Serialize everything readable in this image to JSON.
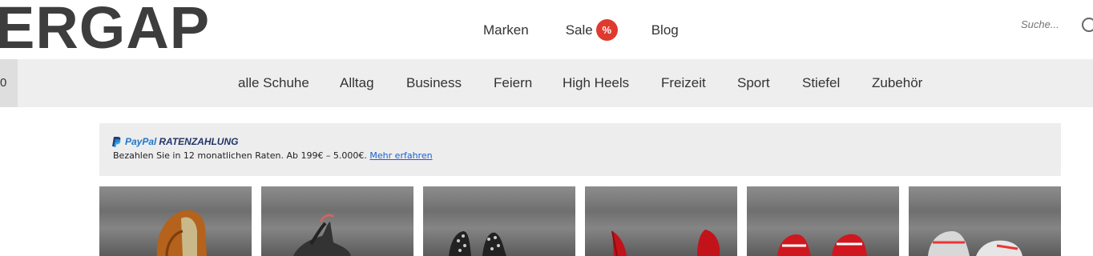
{
  "header": {
    "logo_text": "ERGAP",
    "nav": [
      {
        "label": "Marken"
      },
      {
        "label": "Sale",
        "badge": "%"
      },
      {
        "label": "Blog"
      }
    ],
    "search": {
      "placeholder": "Suche..."
    }
  },
  "category_bar": {
    "cart_stub": "0",
    "items": [
      "alle Schuhe",
      "Alltag",
      "Business",
      "Feiern",
      "High Heels",
      "Freizeit",
      "Sport",
      "Stiefel",
      "Zubehör"
    ]
  },
  "paypal_banner": {
    "brand": "PayPal",
    "title": "RATENZAHLUNG",
    "text": "Bezahlen Sie in 12 monatlichen Raten. Ab 199€ – 5.000€.",
    "link": "Mehr erfahren"
  },
  "category_tiles": [
    {
      "icon": "brown-loafer-shoe"
    },
    {
      "icon": "black-oxford-shoe"
    },
    {
      "icon": "studded-high-heel"
    },
    {
      "icon": "red-high-heel"
    },
    {
      "icon": "red-sneaker"
    },
    {
      "icon": "sport-sneaker"
    }
  ]
}
